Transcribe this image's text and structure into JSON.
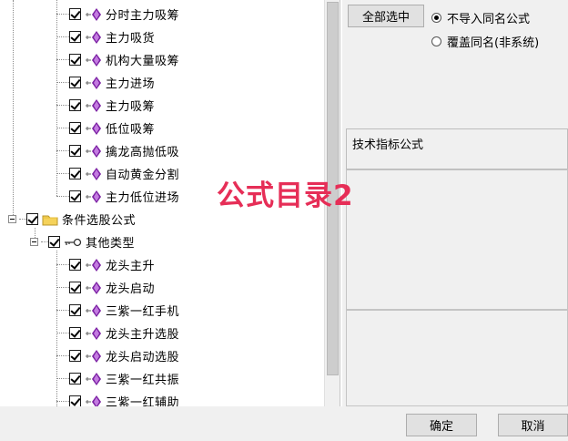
{
  "tree": {
    "items": [
      {
        "label": "分时主力吸筹",
        "type": "formula"
      },
      {
        "label": "主力吸货",
        "type": "formula"
      },
      {
        "label": "机构大量吸筹",
        "type": "formula"
      },
      {
        "label": "主力进场",
        "type": "formula"
      },
      {
        "label": "主力吸筹",
        "type": "formula"
      },
      {
        "label": "低位吸筹",
        "type": "formula"
      },
      {
        "label": "擒龙高抛低吸",
        "type": "formula"
      },
      {
        "label": "自动黄金分割",
        "type": "formula"
      },
      {
        "label": "主力低位进场",
        "type": "formula"
      },
      {
        "label": "条件选股公式",
        "type": "folder"
      },
      {
        "label": "其他类型",
        "type": "key"
      },
      {
        "label": "龙头主升",
        "type": "formula"
      },
      {
        "label": "龙头启动",
        "type": "formula"
      },
      {
        "label": "三紫一红手机",
        "type": "formula"
      },
      {
        "label": "龙头主升选股",
        "type": "formula"
      },
      {
        "label": "龙头启动选股",
        "type": "formula"
      },
      {
        "label": "三紫一红共振",
        "type": "formula"
      },
      {
        "label": "三紫一红辅助",
        "type": "formula"
      }
    ]
  },
  "right": {
    "select_all_label": "全部选中",
    "radio_no_import": "不导入同名公式",
    "radio_overwrite": "覆盖同名(非系统)",
    "formula_box_label": "技术指标公式"
  },
  "footer": {
    "ok_label": "确定",
    "cancel_label": "取消"
  },
  "overlay": {
    "watermark": "公式目录2"
  },
  "colors": {
    "watermark": "#e62e57",
    "formula_icon": "#7a1fa2"
  }
}
